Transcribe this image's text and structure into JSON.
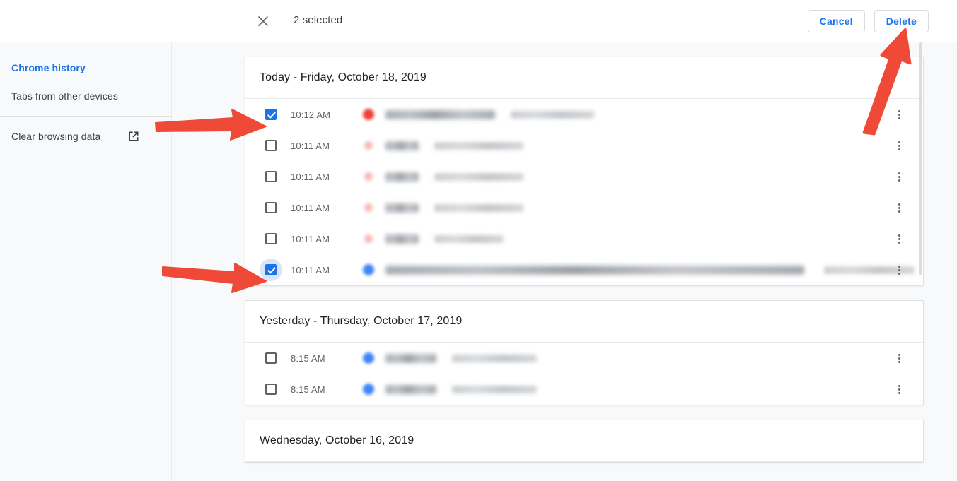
{
  "toolbar": {
    "close_icon": "close-icon",
    "selection_label": "2 selected",
    "cancel_label": "Cancel",
    "delete_label": "Delete",
    "accent_color": "#1a73e8",
    "border_color": "#dadce0"
  },
  "sidebar": {
    "items": [
      {
        "label": "Chrome history",
        "active": true,
        "external": false
      },
      {
        "label": "Tabs from other devices",
        "active": false,
        "external": false
      },
      {
        "label": "Clear browsing data",
        "active": false,
        "external": true,
        "icon": "open-in-new-icon"
      }
    ]
  },
  "content": {
    "cards": [
      {
        "header": "Today - Friday, October 18, 2019",
        "rows": [
          {
            "time": "10:12 AM",
            "checked": true,
            "focus_ring": false,
            "favicon": "red",
            "title_w": 155,
            "url_w": 118,
            "url_pos": "inline"
          },
          {
            "time": "10:11 AM",
            "checked": false,
            "focus_ring": false,
            "favicon": "gmail",
            "title_w": 47,
            "url_w": 126,
            "url_pos": "inline"
          },
          {
            "time": "10:11 AM",
            "checked": false,
            "focus_ring": false,
            "favicon": "gmail",
            "title_w": 47,
            "url_w": 126,
            "url_pos": "inline"
          },
          {
            "time": "10:11 AM",
            "checked": false,
            "focus_ring": false,
            "favicon": "gmail",
            "title_w": 47,
            "url_w": 126,
            "url_pos": "inline"
          },
          {
            "time": "10:11 AM",
            "checked": false,
            "focus_ring": false,
            "favicon": "gmail",
            "title_w": 47,
            "url_w": 98,
            "url_pos": "inline"
          },
          {
            "time": "10:11 AM",
            "checked": true,
            "focus_ring": true,
            "favicon": "blue",
            "title_w": 592,
            "url_w": 128,
            "url_pos": "far"
          }
        ]
      },
      {
        "header": "Yesterday - Thursday, October 17, 2019",
        "rows": [
          {
            "time": "8:15 AM",
            "checked": false,
            "focus_ring": false,
            "favicon": "blue",
            "title_w": 72,
            "url_w": 120,
            "url_pos": "inline"
          },
          {
            "time": "8:15 AM",
            "checked": false,
            "focus_ring": false,
            "favicon": "blue",
            "title_w": 72,
            "url_w": 120,
            "url_pos": "inline"
          }
        ]
      },
      {
        "header": "Wednesday, October 16, 2019",
        "rows": []
      }
    ]
  },
  "annotations": {
    "color": "#ef4a38",
    "arrows": [
      {
        "name": "arrow-to-checkbox-row-1",
        "target": "first-row-checkbox"
      },
      {
        "name": "arrow-to-checkbox-row-6",
        "target": "sixth-row-checkbox"
      },
      {
        "name": "arrow-to-delete-button",
        "target": "delete-button"
      }
    ]
  },
  "scrollbar": {
    "thumb_top": 0,
    "thumb_height": 330
  }
}
